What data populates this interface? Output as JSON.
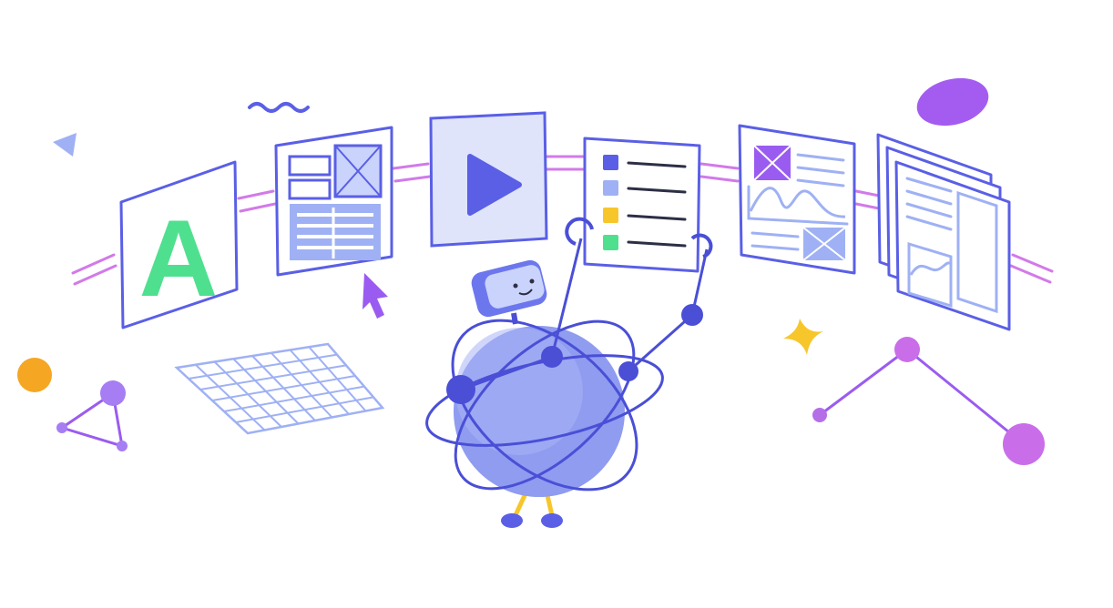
{
  "scene": {
    "letter_card": {
      "letter": "A"
    },
    "colors": {
      "outline": "#5a5fe6",
      "light_blue": "#9fb1f4",
      "pale_blue": "#c9d3fb",
      "green": "#4fe08f",
      "purple": "#9a5cf0",
      "magenta": "#c96ee8",
      "pink_link": "#d27ae9",
      "yellow": "#f7c62a",
      "orange": "#f5a623",
      "robot_body": "#8f9cf0",
      "dark_ink": "#2c2f45"
    },
    "icons": [
      "letter-a-card-icon",
      "layout-card-icon",
      "video-play-card-icon",
      "checklist-card-icon",
      "article-card-icon",
      "stacked-pages-card-icon",
      "cursor-arrow-icon",
      "robot-icon",
      "grid-plane-icon",
      "triangle-shape-icon",
      "wave-squiggle-icon",
      "sparkle-star-icon",
      "node-graph-icon",
      "oval-blob-icon",
      "orange-dot-icon"
    ]
  }
}
